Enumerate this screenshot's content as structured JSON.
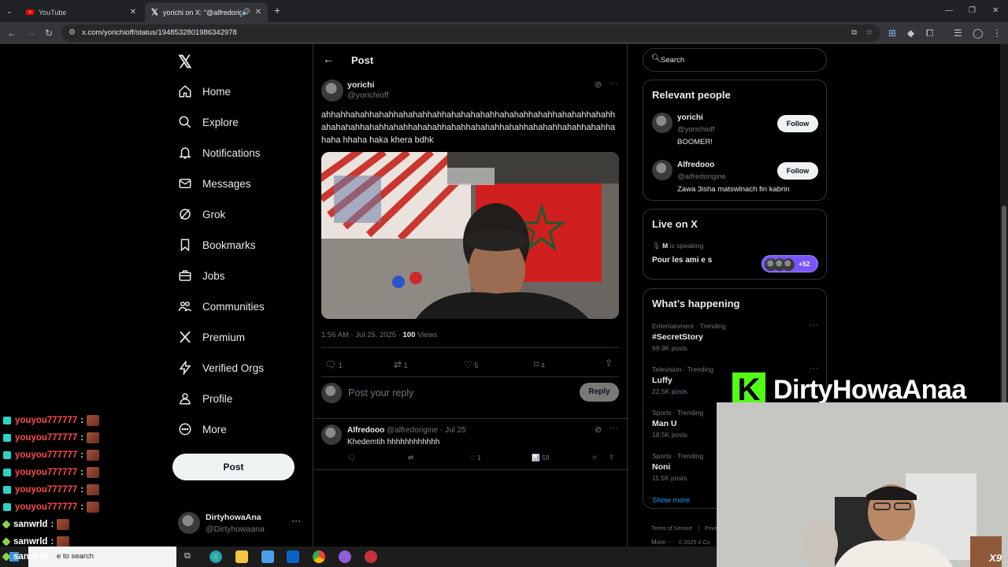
{
  "browser": {
    "tabs": [
      {
        "title": "YouTube"
      },
      {
        "title": "yorichi on X: \"@alfredorigin"
      }
    ],
    "url": "x.com/yorichioff/status/1948532801986342978"
  },
  "nav": {
    "items": [
      {
        "label": "Home",
        "icon": "home-icon"
      },
      {
        "label": "Explore",
        "icon": "search-icon"
      },
      {
        "label": "Notifications",
        "icon": "bell-icon"
      },
      {
        "label": "Messages",
        "icon": "mail-icon"
      },
      {
        "label": "Grok",
        "icon": "grok-icon"
      },
      {
        "label": "Bookmarks",
        "icon": "bookmark-icon"
      },
      {
        "label": "Jobs",
        "icon": "briefcase-icon"
      },
      {
        "label": "Communities",
        "icon": "people-icon"
      },
      {
        "label": "Premium",
        "icon": "x-icon"
      },
      {
        "label": "Verified Orgs",
        "icon": "lightning-icon"
      },
      {
        "label": "Profile",
        "icon": "person-icon"
      },
      {
        "label": "More",
        "icon": "more-circle-icon"
      }
    ],
    "post_button": "Post",
    "account": {
      "name": "DirtyhowaAna",
      "handle": "@Dirtyhowaana"
    }
  },
  "main": {
    "header": "Post",
    "tweet": {
      "name": "yorichi",
      "handle": "@yorichioff",
      "text": "ahhahhahahhahahhahahahhahhahahahahahhahahahhahahhahahahhahahhahahahahhahahhahahhahahahhahahhahahahhahahhahahahhahahhahahhahaha hhaha haka khera bdhk",
      "time": "1:56 AM · Jul 25, 2025 · ",
      "views_count": "100",
      "views_label": "Views",
      "replies": "1",
      "reposts": "1",
      "likes": "5",
      "bookmarks": "4"
    },
    "reply_box": {
      "placeholder": "Post your reply",
      "button": "Reply"
    },
    "reply": {
      "name": "Alfredooo",
      "handle": "@alfredorigine",
      "date": "· Jul 25",
      "text": "Khedemtih hhhhhhhhhhhh",
      "likes": "1",
      "views": "59"
    }
  },
  "right": {
    "search_placeholder": "Search",
    "relevant": {
      "title": "Relevant people",
      "people": [
        {
          "name": "yorichi",
          "handle": "@yorichioff",
          "bio": "BOOMER!",
          "button": "Follow"
        },
        {
          "name": "Alfredooo",
          "handle": "@alfredorigine",
          "bio": "Zawa 3isha matswlnach fin kabrin",
          "button": "Follow"
        }
      ]
    },
    "live": {
      "title": "Live on X",
      "host": "M",
      "speaking": "is speaking",
      "space_title": "Pour les ami e s",
      "count": "+52"
    },
    "happening": {
      "title": "What’s happening",
      "trends": [
        {
          "category": "Entertainment · Trending",
          "name": "#SecretStory",
          "count": "69.9K posts"
        },
        {
          "category": "Television · Trending",
          "name": "Luffy",
          "count": "22.5K posts"
        },
        {
          "category": "Sports · Trending",
          "name": "Man U",
          "count": "18.5K posts"
        },
        {
          "category": "Sports · Trending",
          "name": "Noni",
          "count": "11.5K posts"
        }
      ],
      "show_more": "Show more"
    },
    "footer": {
      "terms": "Terms of Service",
      "privacy": "Priva",
      "more": "More ···",
      "copyright": "© 2025 X Co"
    }
  },
  "overlay": {
    "chat": [
      {
        "user": "youyou777777",
        "sep": ":",
        "color": "#ff4c4c",
        "badge_color": "#2bd4c4"
      },
      {
        "user": "youyou777777",
        "sep": ":",
        "color": "#ff4c4c",
        "badge_color": "#2bd4c4"
      },
      {
        "user": "youyou777777",
        "sep": ":",
        "color": "#ff4c4c",
        "badge_color": "#2bd4c4"
      },
      {
        "user": "youyou777777",
        "sep": ":",
        "color": "#ff4c4c",
        "badge_color": "#2bd4c4"
      },
      {
        "user": "youyou777777",
        "sep": ":",
        "color": "#ff4c4c",
        "badge_color": "#2bd4c4"
      },
      {
        "user": "youyou777777",
        "sep": ":",
        "color": "#ff4c4c",
        "badge_color": "#2bd4c4"
      },
      {
        "user": "sanwrld",
        "sep": ":",
        "color": "#ffffff",
        "badge_color": "#8bd34a"
      },
      {
        "user": "sanwrld",
        "sep": ":",
        "color": "#ffffff",
        "badge_color": "#8bd34a"
      },
      {
        "user": "sanwrld",
        "sep": ":",
        "color": "#ffffff",
        "badge_color": "#8bd34a"
      }
    ],
    "taskbar_search": "e to search",
    "streamer_logo": "K",
    "streamer_name": "DirtyHowaAnaa",
    "cam_badge": "X9"
  }
}
